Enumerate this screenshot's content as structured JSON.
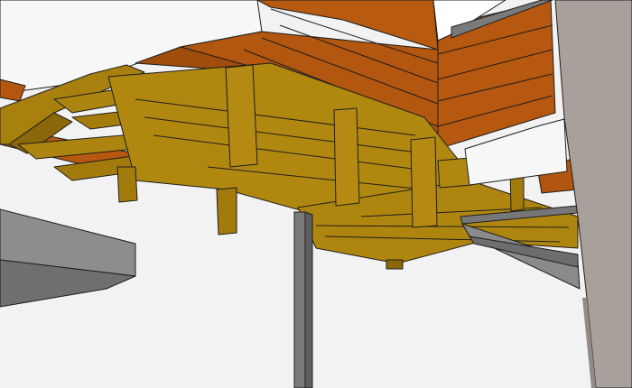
{
  "scene": {
    "kind": "3d-render-wooden-deck-framing-underside",
    "background_color": "#f2f2f2",
    "deck_board_color": "#b8580f",
    "deck_board_dark_color": "#8e3f06",
    "framing_color": "#a8800e",
    "framing_dark_color": "#8a6708",
    "steel_color": "#7a7a7a",
    "wall_color": "#a8a09a",
    "slab_color": "#8c8c8c"
  }
}
